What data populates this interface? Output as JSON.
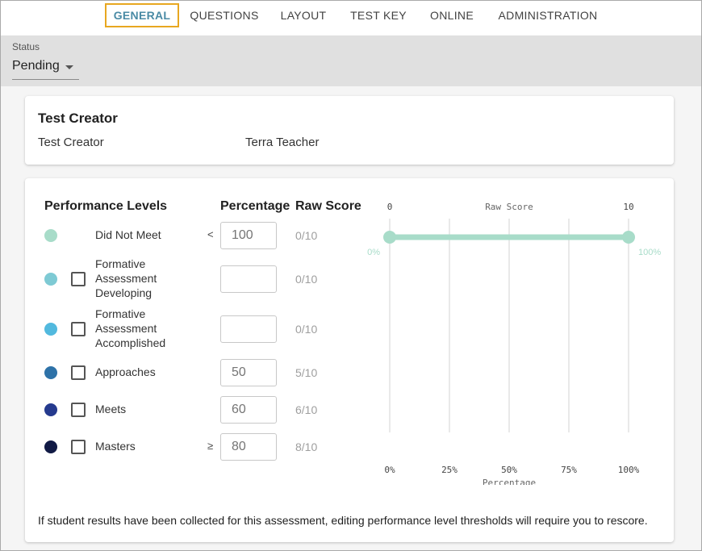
{
  "tabs": [
    {
      "label": "GENERAL",
      "active": true
    },
    {
      "label": "QUESTIONS",
      "active": false
    },
    {
      "label": "LAYOUT",
      "active": false
    },
    {
      "label": "TEST KEY",
      "active": false
    },
    {
      "label": "ONLINE",
      "active": false
    },
    {
      "label": "ADMINISTRATION",
      "active": false
    }
  ],
  "status": {
    "label": "Status",
    "value": "Pending"
  },
  "test_creator": {
    "title": "Test Creator",
    "label": "Test Creator",
    "value": "Terra Teacher"
  },
  "performance": {
    "headers": {
      "levels": "Performance Levels",
      "percentage": "Percentage",
      "raw_score": "Raw Score"
    },
    "levels": [
      {
        "name": "Did Not Meet",
        "color": "#a8dcc9",
        "has_checkbox": false,
        "operator": "<",
        "percentage_value": "",
        "percentage_placeholder": "100",
        "raw_score": "0/10"
      },
      {
        "name": "Formative Assessment Developing",
        "color": "#7ecad4",
        "has_checkbox": true,
        "operator": "",
        "percentage_value": "",
        "percentage_placeholder": "",
        "raw_score": "0/10"
      },
      {
        "name": "Formative Assessment Accomplished",
        "color": "#52b9de",
        "has_checkbox": true,
        "operator": "",
        "percentage_value": "",
        "percentage_placeholder": "",
        "raw_score": "0/10"
      },
      {
        "name": "Approaches",
        "color": "#2e72a8",
        "has_checkbox": true,
        "operator": "",
        "percentage_value": "",
        "percentage_placeholder": "50",
        "raw_score": "5/10"
      },
      {
        "name": "Meets",
        "color": "#253a8e",
        "has_checkbox": true,
        "operator": "",
        "percentage_value": "",
        "percentage_placeholder": "60",
        "raw_score": "6/10"
      },
      {
        "name": "Masters",
        "color": "#111a45",
        "has_checkbox": true,
        "operator": "≥",
        "percentage_value": "",
        "percentage_placeholder": "80",
        "raw_score": "8/10"
      }
    ],
    "footer_note": "If student results have been collected for this assessment, editing performance level thresholds will require you to rescore."
  },
  "chart_data": {
    "type": "line",
    "raw_score_axis": {
      "label": "Raw Score",
      "min": 0,
      "max": 10,
      "ticks": [
        "0",
        "10"
      ]
    },
    "percentage_axis": {
      "label": "Percentage",
      "ticks": [
        "0%",
        "25%",
        "50%",
        "75%",
        "100%"
      ],
      "values": [
        0,
        25,
        50,
        75,
        100
      ]
    },
    "segments": [
      {
        "level": "Did Not Meet",
        "start_percent": 0,
        "end_percent": 100,
        "start_label": "0%",
        "end_label": "100%",
        "color": "#a8dcc9"
      }
    ],
    "grid": true
  }
}
